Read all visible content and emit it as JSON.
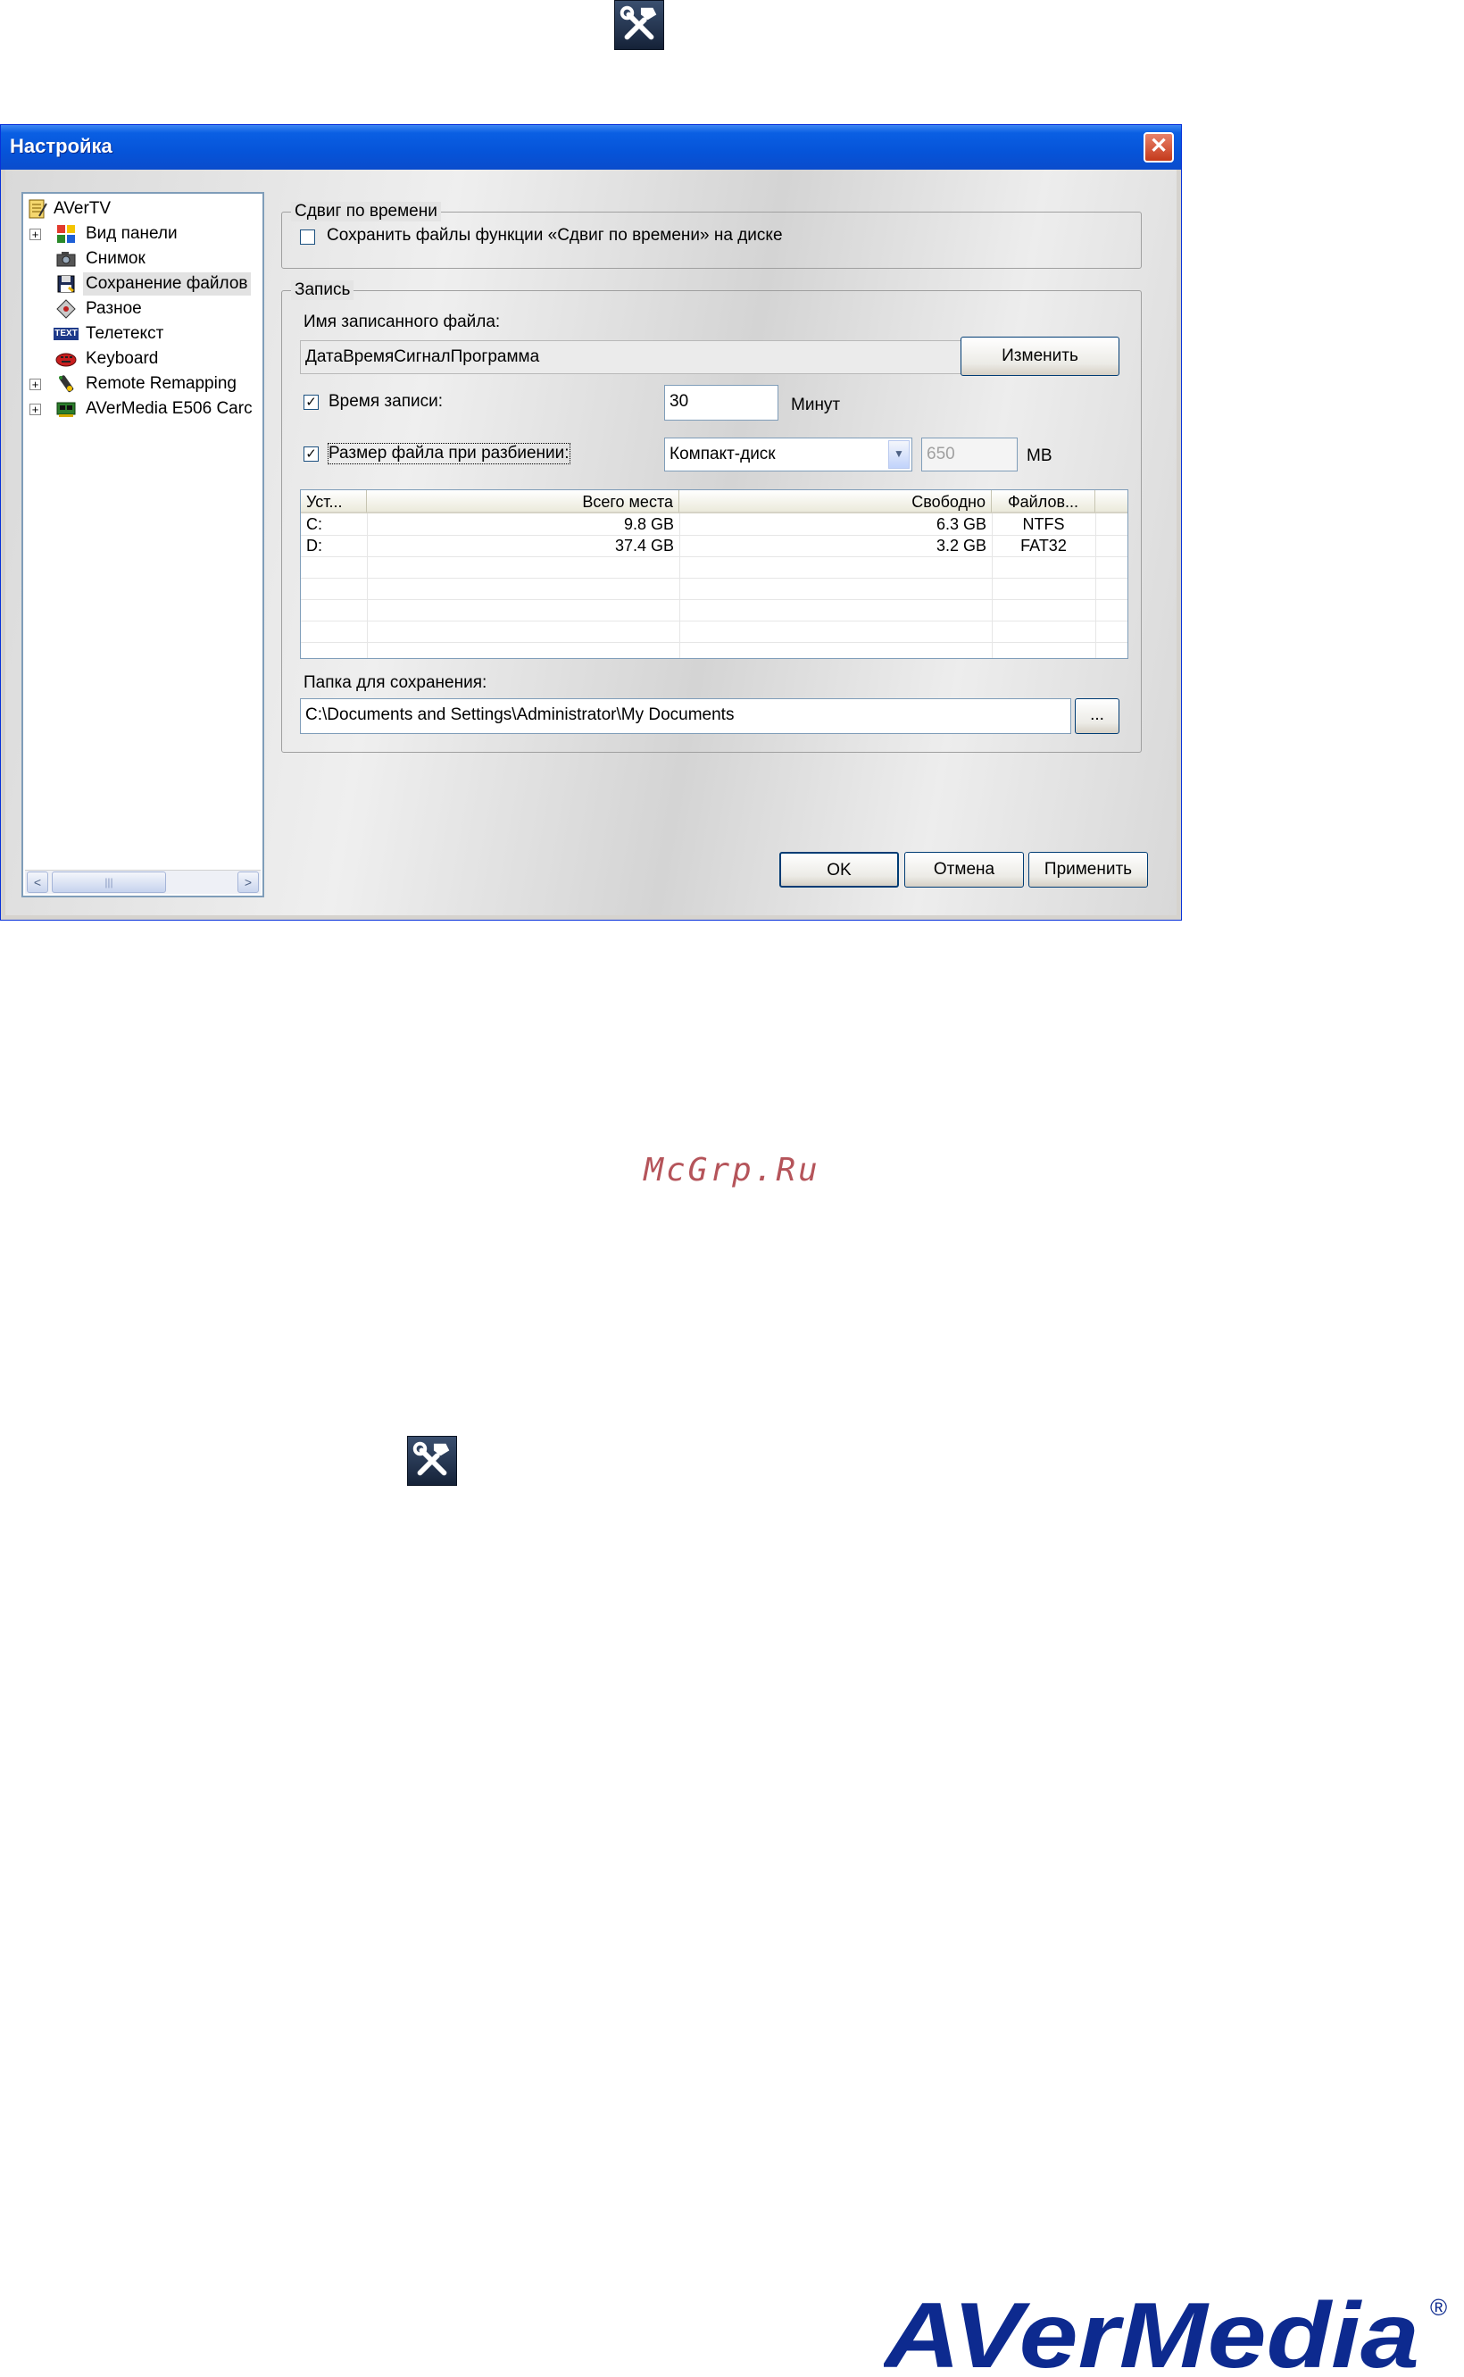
{
  "dialog": {
    "title": "Настройка",
    "close_glyph": "✕"
  },
  "tree": {
    "items": [
      {
        "label": "AVerTV",
        "icon": "notepad-icon",
        "expandable": false
      },
      {
        "label": "Вид панели",
        "icon": "color-squares-icon",
        "expandable": true
      },
      {
        "label": "Снимок",
        "icon": "camera-icon",
        "expandable": false
      },
      {
        "label": "Сохранение файлов",
        "icon": "floppy-disk-icon",
        "expandable": false,
        "selected": true
      },
      {
        "label": "Разное",
        "icon": "diamond-icon",
        "expandable": false
      },
      {
        "label": "Телетекст",
        "icon": "text-icon",
        "expandable": false
      },
      {
        "label": "Keyboard",
        "icon": "keyboard-icon",
        "expandable": false
      },
      {
        "label": "Remote Remapping",
        "icon": "remote-icon",
        "expandable": true
      },
      {
        "label": "AVerMedia E506 Carc",
        "icon": "card-icon",
        "expandable": true
      }
    ],
    "text_icon_label": "TEXT",
    "scroll_left": "<",
    "scroll_right": ">",
    "scroll_thumb_grip": "|||"
  },
  "timeshift": {
    "legend": "Сдвиг по времени",
    "save_checkbox_label": "Сохранить файлы функции «Сдвиг по времени» на диске",
    "save_checked": false
  },
  "record": {
    "legend": "Запись",
    "filename_label": "Имя записанного файла:",
    "filename_value": "ДатаВремяСигналПрограмма",
    "change_button": "Изменить",
    "record_time_label": "Время записи:",
    "record_time_checked": true,
    "record_time_value": "30",
    "record_time_unit": "Минут",
    "split_label": "Размер файла при разбиении:",
    "split_checked": true,
    "split_type_value": "Компакт-диск",
    "split_size_value": "650",
    "split_size_unit": "MB",
    "drives_table": {
      "columns": [
        "Уст...",
        "Всего места",
        "Свободно",
        "Файлов..."
      ],
      "rows": [
        [
          "C:",
          "9.8 GB",
          "6.3 GB",
          "NTFS"
        ],
        [
          "D:",
          "37.4 GB",
          "3.2 GB",
          "FAT32"
        ]
      ]
    },
    "folder_label": "Папка для сохранения:",
    "folder_value": "C:\\Documents and Settings\\Administrator\\My Documents",
    "browse_button": "..."
  },
  "buttons": {
    "ok": "OK",
    "cancel": "Отмена",
    "apply": "Применить"
  },
  "watermark": "McGrp.Ru",
  "logo": {
    "text": "AVerMedia",
    "registered": "®",
    "color": "#0d2a8f"
  },
  "check_glyph": "✓",
  "combo_arrow_glyph": "▼"
}
